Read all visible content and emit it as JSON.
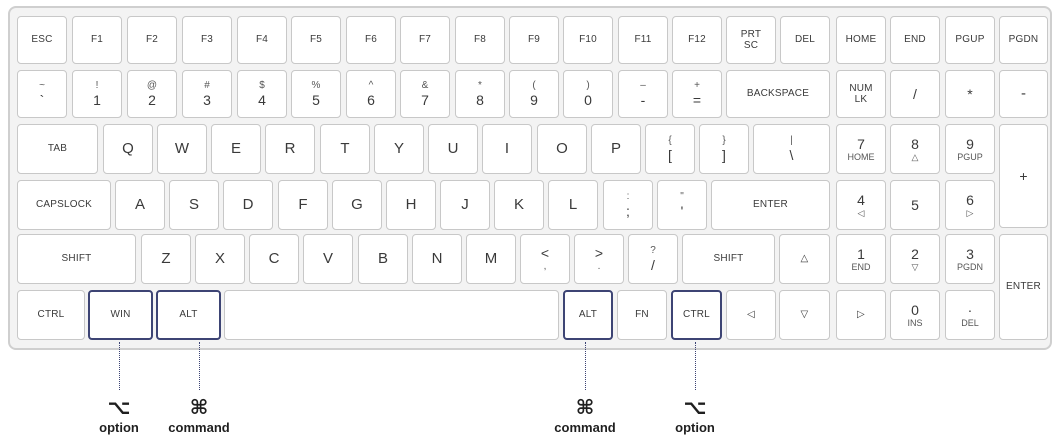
{
  "accent": "#3d4474",
  "row1": [
    "ESC",
    "F1",
    "F2",
    "F3",
    "F4",
    "F5",
    "F6",
    "F7",
    "F8",
    "F9",
    "F10",
    "F11",
    "F12",
    "PRT\nSC",
    "DEL",
    "HOME",
    "END",
    "PGUP",
    "PGDN"
  ],
  "row2": [
    {
      "top": "~",
      "bottom": "`"
    },
    {
      "top": "!",
      "bottom": "1"
    },
    {
      "top": "@",
      "bottom": "2"
    },
    {
      "top": "#",
      "bottom": "3"
    },
    {
      "top": "$",
      "bottom": "4"
    },
    {
      "top": "%",
      "bottom": "5"
    },
    {
      "top": "^",
      "bottom": "6"
    },
    {
      "top": "&",
      "bottom": "7"
    },
    {
      "top": "*",
      "bottom": "8"
    },
    {
      "top": "(",
      "bottom": "9"
    },
    {
      "top": ")",
      "bottom": "0"
    },
    {
      "top": "–",
      "bottom": "-"
    },
    {
      "top": "+",
      "bottom": "="
    }
  ],
  "backspace": "BACKSPACE",
  "numlk": "NUM\nLK",
  "np_div": "/",
  "np_mul": "*",
  "np_minus": "-",
  "np_plus": "+",
  "np_enter": "ENTER",
  "tab": "TAB",
  "row3": [
    "Q",
    "W",
    "E",
    "R",
    "T",
    "Y",
    "U",
    "I",
    "O",
    "P"
  ],
  "row3sym": [
    {
      "top": "{",
      "bottom": "["
    },
    {
      "top": "}",
      "bottom": "]"
    },
    {
      "top": "|",
      "bottom": "\\"
    }
  ],
  "np7": {
    "top": "7",
    "bottom": "HOME"
  },
  "np8": {
    "top": "8",
    "bottom": "△"
  },
  "np9": {
    "top": "9",
    "bottom": "PGUP"
  },
  "capslock": "CAPSLOCK",
  "row4": [
    "A",
    "S",
    "D",
    "F",
    "G",
    "H",
    "J",
    "K",
    "L"
  ],
  "row4sym": [
    {
      "top": ":",
      "bottom": ";"
    },
    {
      "top": "\"",
      "bottom": "'"
    }
  ],
  "enter": "ENTER",
  "np4": {
    "top": "4",
    "bottom": "◁"
  },
  "np5": "5",
  "np6": {
    "top": "6",
    "bottom": "▷"
  },
  "shift": "SHIFT",
  "row5": [
    "Z",
    "X",
    "C",
    "V",
    "B",
    "N",
    "M"
  ],
  "row5sym": [
    {
      "top": "<",
      "bottom": ","
    },
    {
      "top": ">",
      "bottom": "."
    },
    {
      "top": "?",
      "bottom": "/"
    }
  ],
  "shift_r": "SHIFT",
  "arrow_up": "△",
  "np1": {
    "top": "1",
    "bottom": "END"
  },
  "np2": {
    "top": "2",
    "bottom": "▽"
  },
  "np3": {
    "top": "3",
    "bottom": "PGDN"
  },
  "ctrl": "CTRL",
  "win": "WIN",
  "alt": "ALT",
  "alt_r": "ALT",
  "fn": "FN",
  "ctrl_r": "CTRL",
  "arrow_left": "◁",
  "arrow_down": "▽",
  "arrow_right": "▷",
  "np0": {
    "top": "0",
    "bottom": "INS"
  },
  "np_dot": {
    "top": "·",
    "bottom": "DEL"
  },
  "callouts": [
    {
      "glyph": "⌥",
      "word": "option"
    },
    {
      "glyph": "⌘",
      "word": "command"
    },
    {
      "glyph": "⌘",
      "word": "command"
    },
    {
      "glyph": "⌥",
      "word": "option"
    }
  ]
}
